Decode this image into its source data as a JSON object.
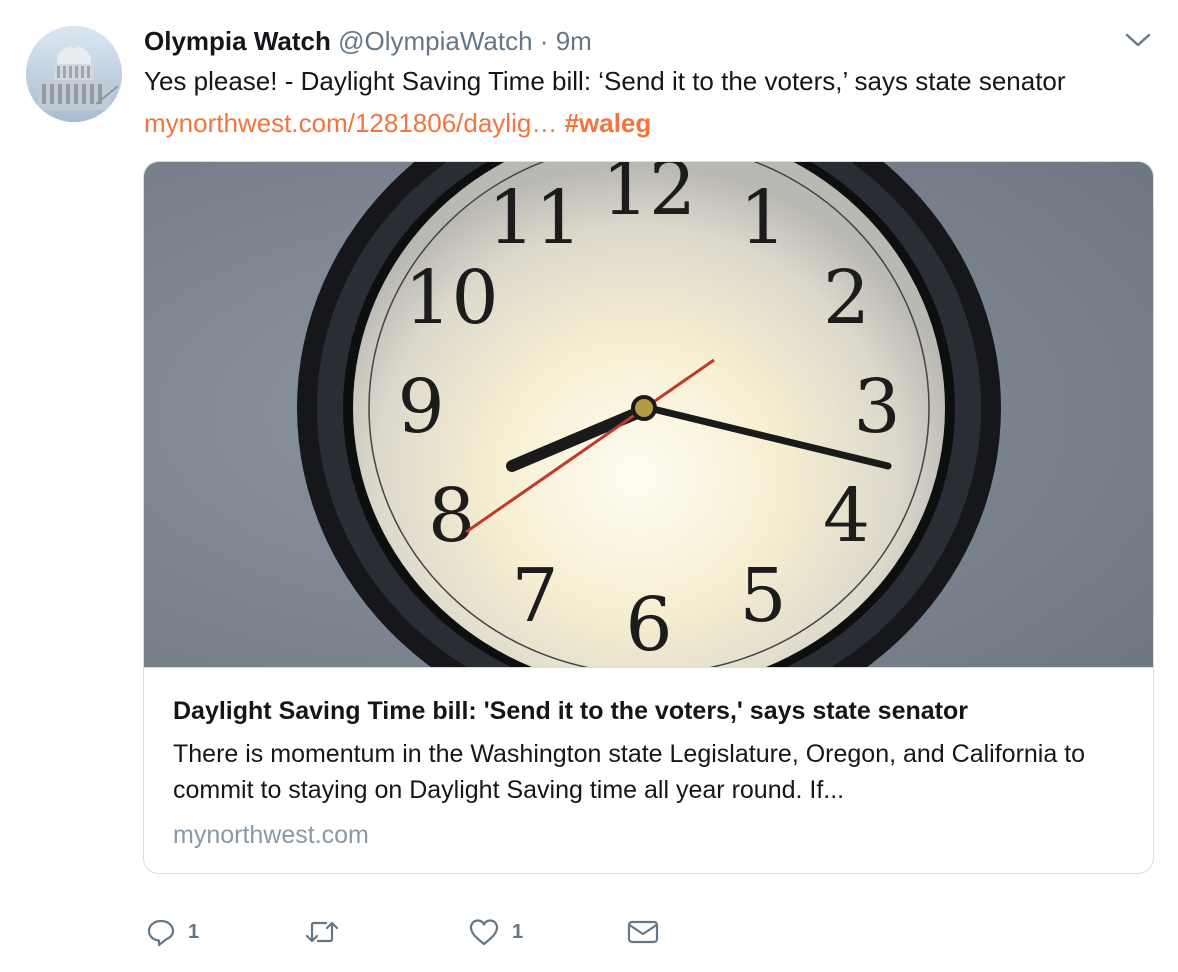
{
  "tweet": {
    "author_name": "Olympia Watch",
    "author_handle": "@OlympiaWatch",
    "separator": "·",
    "timestamp": "9m",
    "text": "Yes please! - Daylight Saving Time bill: ‘Send it to the voters,’ says state senator",
    "link_text": "mynorthwest.com/1281806/daylig…",
    "hashtag": "#waleg"
  },
  "card": {
    "title": "Daylight Saving Time bill: 'Send it to the voters,' says state senator",
    "description": "There is momentum in the Washington state Legislature, Oregon, and California to commit to staying on Daylight Saving time all year round. If...",
    "domain": "mynorthwest.com",
    "clock_numerals": [
      "12",
      "1",
      "2",
      "3",
      "4",
      "5",
      "6",
      "7",
      "8",
      "9",
      "10",
      "11"
    ]
  },
  "actions": {
    "reply_count": "1",
    "like_count": "1"
  },
  "icons": {
    "caret": "chevron-down-icon",
    "reply": "reply-icon",
    "retweet": "retweet-icon",
    "like": "heart-icon",
    "dm": "envelope-icon"
  },
  "colors": {
    "link": "#f4743d",
    "muted": "#657786",
    "border": "#d7dde2"
  }
}
